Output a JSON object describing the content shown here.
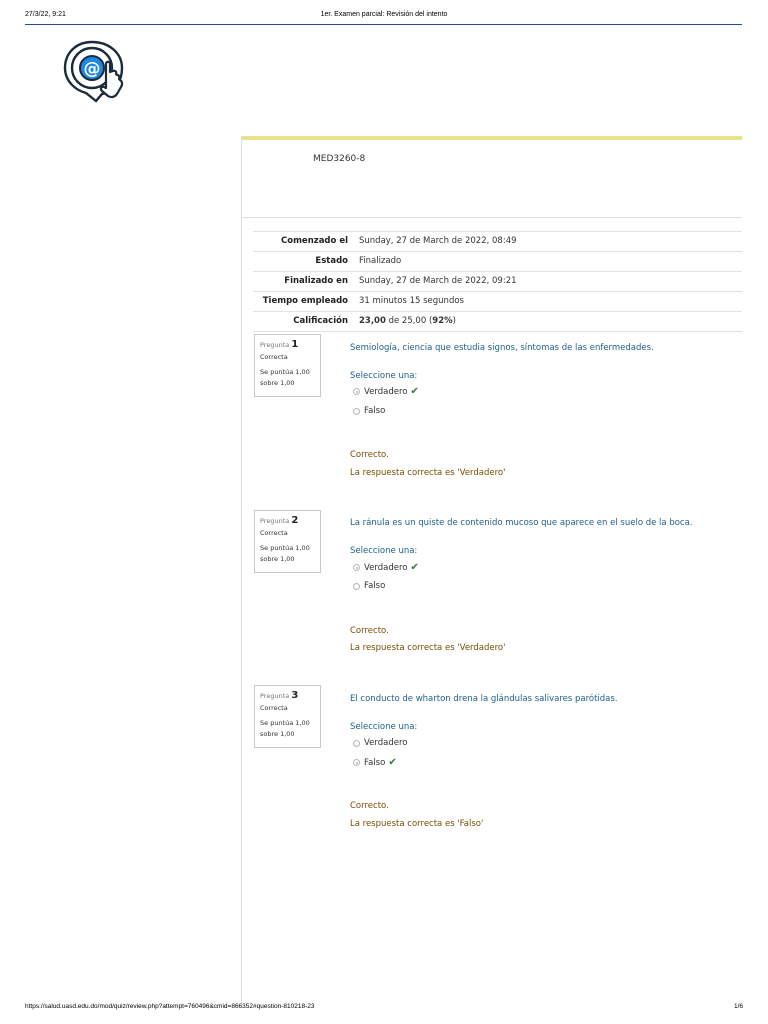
{
  "print_header": {
    "datetime": "27/3/22, 9:21",
    "title": "1er. Examen parcial: Revisión del intento"
  },
  "logo": {
    "icon": "at-sign-hand-pointer-icon"
  },
  "course": {
    "code": "MED3260-8"
  },
  "summary": [
    {
      "label": "Comenzado el",
      "value": "Sunday, 27 de March de 2022, 08:49"
    },
    {
      "label": "Estado",
      "value": "Finalizado"
    },
    {
      "label": "Finalizado en",
      "value": "Sunday, 27 de March de 2022, 09:21"
    },
    {
      "label": "Tiempo empleado",
      "value": "31 minutos 15 segundos"
    },
    {
      "label": "Calificación",
      "value_bold": "23,00",
      "value_mid": " de 25,00 (",
      "value_pct": "92%",
      "value_end": ")"
    }
  ],
  "questions": [
    {
      "label": "Pregunta",
      "number": "1",
      "state": "Correcta",
      "grade": "Se puntúa 1,00 sobre 1,00",
      "text": "Semiología, ciencia que estudia signos, síntomas de las enfermedades.",
      "prompt": "Seleccione una:",
      "options": [
        {
          "label": "Verdadero",
          "selected": true,
          "correct_mark": "✔"
        },
        {
          "label": "Falso",
          "selected": false,
          "correct_mark": ""
        }
      ],
      "feedback": "Correcto.",
      "right_answer": "La respuesta correcta es 'Verdadero'"
    },
    {
      "label": "Pregunta",
      "number": "2",
      "state": "Correcta",
      "grade": "Se puntúa 1,00 sobre 1,00",
      "text": "La ránula es un quiste de contenido mucoso que aparece en el suelo de la boca.",
      "prompt": "Seleccione una:",
      "options": [
        {
          "label": "Verdadero",
          "selected": true,
          "correct_mark": "✔"
        },
        {
          "label": "Falso",
          "selected": false,
          "correct_mark": ""
        }
      ],
      "feedback": "Correcto.",
      "right_answer": "La respuesta correcta es 'Verdadero'"
    },
    {
      "label": "Pregunta",
      "number": "3",
      "state": "Correcta",
      "grade": "Se puntúa 1,00 sobre 1,00",
      "text": "El conducto de wharton drena la glándulas salivares parótidas.",
      "prompt": "Seleccione una:",
      "options": [
        {
          "label": "Verdadero",
          "selected": false,
          "correct_mark": ""
        },
        {
          "label": "Falso",
          "selected": true,
          "correct_mark": "✔"
        }
      ],
      "feedback": "Correcto.",
      "right_answer": "La respuesta correcta es 'Falso'"
    }
  ],
  "print_footer": {
    "url": "https://salud.uasd.edu.do/mod/quiz/review.php?attempt=760496&cmid=866352#question-810218-23",
    "page": "1/6"
  },
  "colors": {
    "accent_bar": "#e8e28a",
    "question_text": "#1d5f8a",
    "feedback_text": "#7a4c00",
    "check_green": "#2f7d32",
    "header_rule": "#2b4a8b"
  }
}
